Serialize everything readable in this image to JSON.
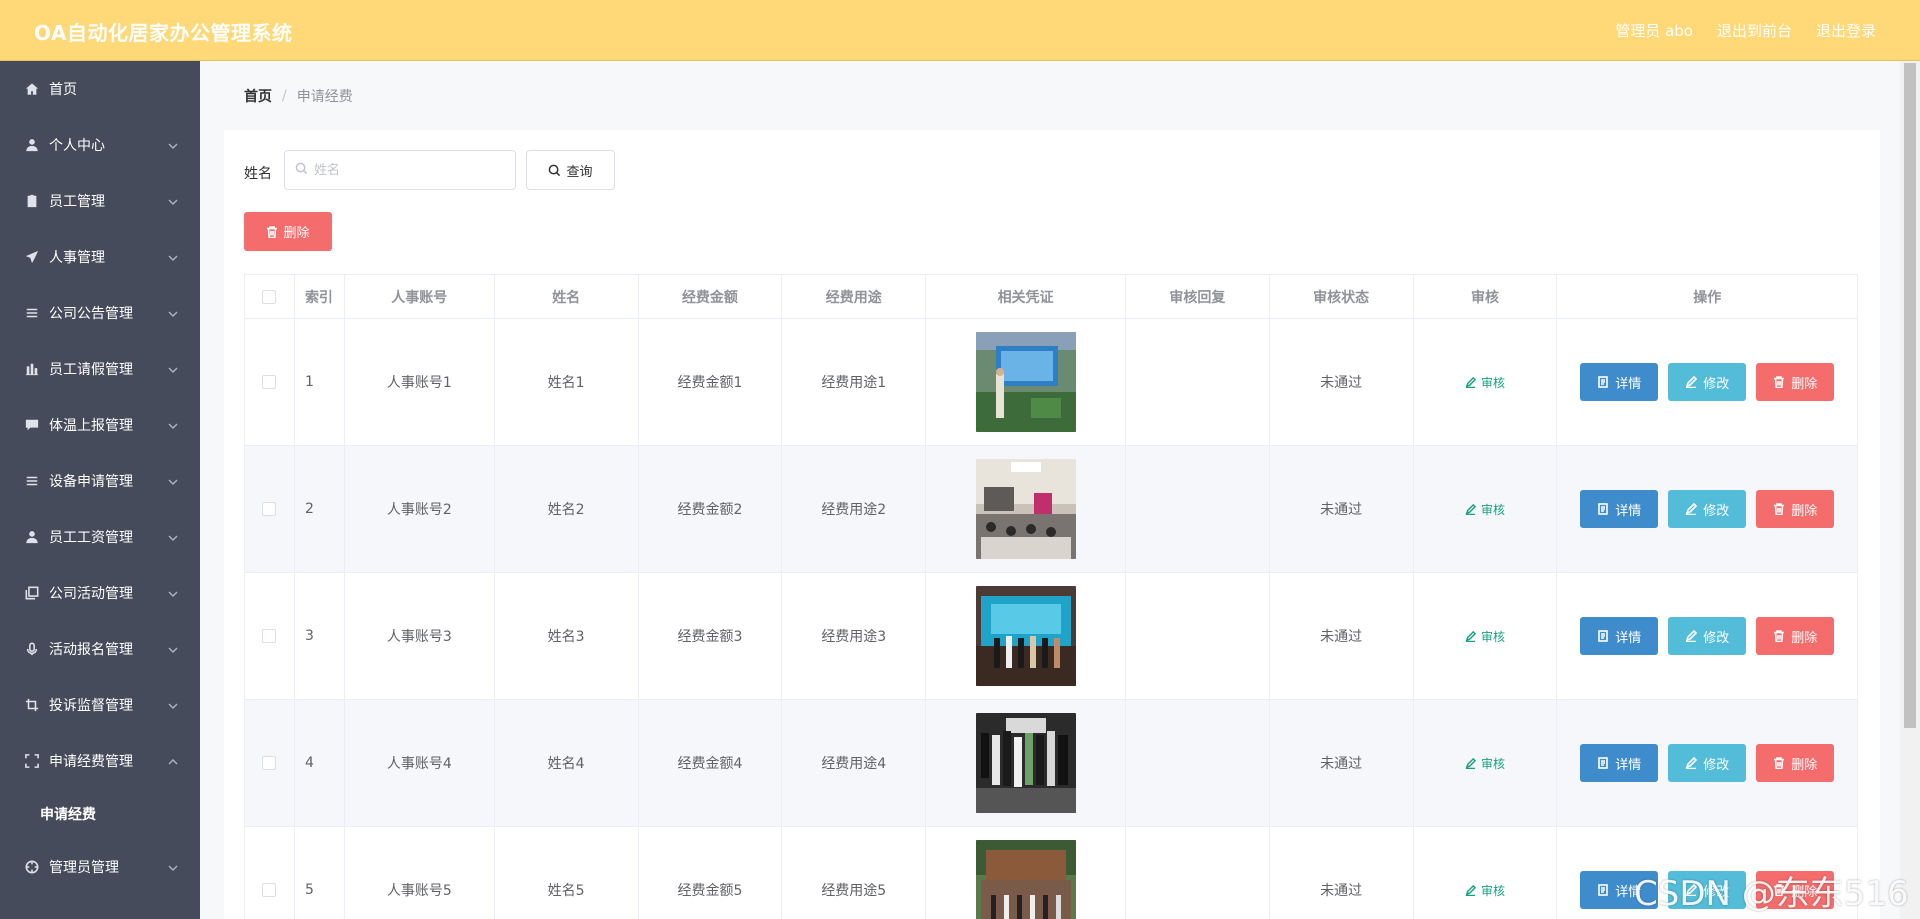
{
  "header": {
    "title": "OA自动化居家办公管理系统",
    "user_label": "管理员 abo",
    "front_label": "退出到前台",
    "logout_label": "退出登录"
  },
  "sidebar": {
    "items": [
      {
        "label": "首页",
        "icon": "home-icon",
        "expandable": false
      },
      {
        "label": "个人中心",
        "icon": "user-icon",
        "expandable": true
      },
      {
        "label": "员工管理",
        "icon": "clipboard-icon",
        "expandable": true
      },
      {
        "label": "人事管理",
        "icon": "paper-plane-icon",
        "expandable": true
      },
      {
        "label": "公司公告管理",
        "icon": "menu-lines-icon",
        "expandable": true
      },
      {
        "label": "员工请假管理",
        "icon": "bar-chart-icon",
        "expandable": true
      },
      {
        "label": "体温上报管理",
        "icon": "chat-icon",
        "expandable": true
      },
      {
        "label": "设备申请管理",
        "icon": "menu-lines-icon",
        "expandable": true
      },
      {
        "label": "员工工资管理",
        "icon": "user-icon",
        "expandable": true
      },
      {
        "label": "公司活动管理",
        "icon": "copy-icon",
        "expandable": true
      },
      {
        "label": "活动报名管理",
        "icon": "microphone-icon",
        "expandable": true
      },
      {
        "label": "投诉监督管理",
        "icon": "crop-icon",
        "expandable": true
      },
      {
        "label": "申请经费管理",
        "icon": "fullscreen-icon",
        "expandable": true,
        "open": true
      }
    ],
    "sub_item": "申请经费",
    "after_items": [
      {
        "label": "管理员管理",
        "icon": "target-icon",
        "expandable": true
      }
    ]
  },
  "breadcrumb": {
    "home": "首页",
    "separator": "/",
    "current": "申请经费"
  },
  "search": {
    "label": "姓名",
    "placeholder": "姓名",
    "value": "",
    "query_button": "查询"
  },
  "batch_delete_label": "删除",
  "table": {
    "headers": [
      "",
      "索引",
      "人事账号",
      "姓名",
      "经费金额",
      "经费用途",
      "相关凭证",
      "审核回复",
      "审核状态",
      "审核",
      "操作"
    ],
    "rows": [
      {
        "index": "1",
        "account": "人事账号1",
        "name": "姓名1",
        "amount": "经费金额1",
        "purpose": "经费用途1",
        "reply": "",
        "status": "未通过",
        "audit": "审核"
      },
      {
        "index": "2",
        "account": "人事账号2",
        "name": "姓名2",
        "amount": "经费金额2",
        "purpose": "经费用途2",
        "reply": "",
        "status": "未通过",
        "audit": "审核"
      },
      {
        "index": "3",
        "account": "人事账号3",
        "name": "姓名3",
        "amount": "经费金额3",
        "purpose": "经费用途3",
        "reply": "",
        "status": "未通过",
        "audit": "审核"
      },
      {
        "index": "4",
        "account": "人事账号4",
        "name": "姓名4",
        "amount": "经费金额4",
        "purpose": "经费用途4",
        "reply": "",
        "status": "未通过",
        "audit": "审核"
      },
      {
        "index": "5",
        "account": "人事账号5",
        "name": "姓名5",
        "amount": "经费金额5",
        "purpose": "经费用途5",
        "reply": "",
        "status": "未通过",
        "audit": "审核"
      }
    ],
    "actions": {
      "detail": "详情",
      "edit": "修改",
      "delete": "删除"
    }
  },
  "watermark": "CSDN @东东516",
  "colors": {
    "header_bg": "#ffd877",
    "sidebar_bg": "#454b5a",
    "danger": "#f56c6c",
    "primary": "#3f8ccd",
    "info": "#53bcd9",
    "audit_green": "#1aa081"
  }
}
